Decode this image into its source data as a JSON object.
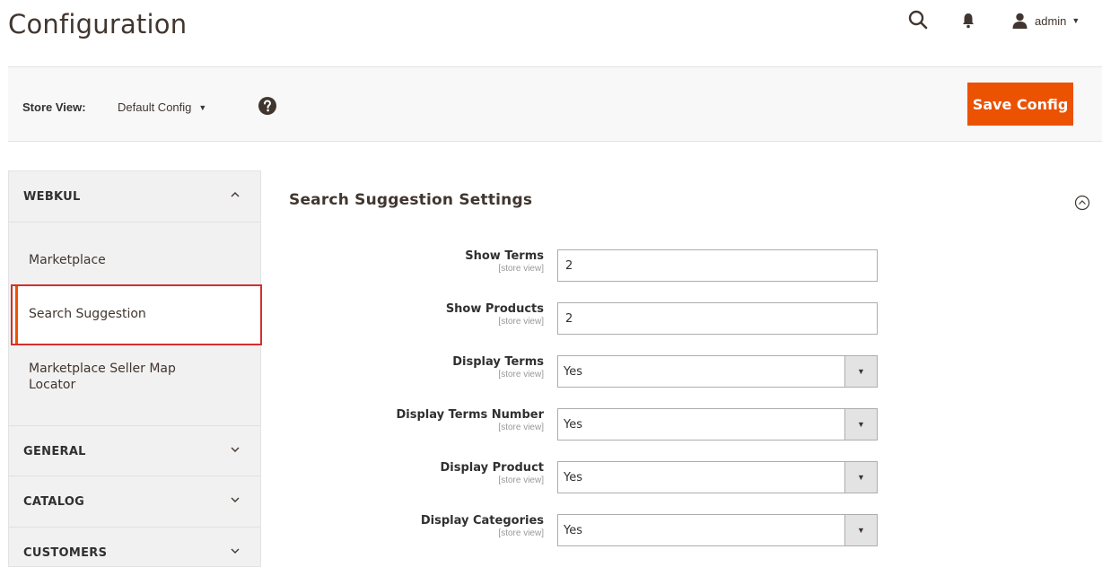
{
  "page": {
    "title": "Configuration"
  },
  "header": {
    "search_icon": "search-icon",
    "bell_icon": "bell-icon",
    "user_icon": "user-icon",
    "username": "admin"
  },
  "store_bar": {
    "label": "Store View:",
    "selected": "Default Config",
    "help_icon": "question-icon",
    "save_label": "Save Config"
  },
  "sidebar": {
    "sections": [
      {
        "title": "WEBKUL",
        "expanded": true,
        "items": [
          "Marketplace",
          "Search Suggestion",
          "Marketplace Seller Map Locator"
        ],
        "active_item": "Search Suggestion"
      },
      {
        "title": "GENERAL",
        "expanded": false
      },
      {
        "title": "CATALOG",
        "expanded": false
      },
      {
        "title": "CUSTOMERS",
        "expanded": false
      }
    ]
  },
  "content": {
    "section_title": "Search Suggestion Settings",
    "fields": [
      {
        "label": "Show Terms",
        "scope": "[store view]",
        "type": "text",
        "value": "2"
      },
      {
        "label": "Show Products",
        "scope": "[store view]",
        "type": "text",
        "value": "2"
      },
      {
        "label": "Display Terms",
        "scope": "[store view]",
        "type": "select",
        "value": "Yes"
      },
      {
        "label": "Display Terms Number",
        "scope": "[store view]",
        "type": "select",
        "value": "Yes"
      },
      {
        "label": "Display Product",
        "scope": "[store view]",
        "type": "select",
        "value": "Yes"
      },
      {
        "label": "Display Categories",
        "scope": "[store view]",
        "type": "select",
        "value": "Yes"
      }
    ]
  },
  "colors": {
    "accent": "#eb5202",
    "highlight_border": "#d32f2f"
  }
}
